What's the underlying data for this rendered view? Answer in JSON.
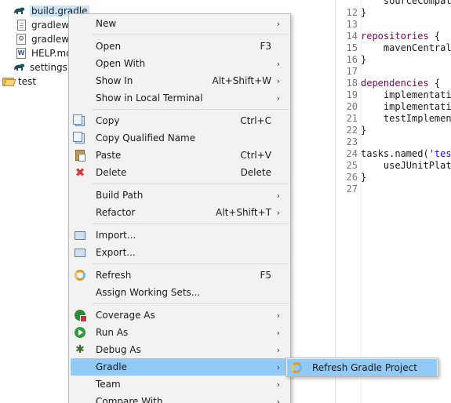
{
  "explorer": {
    "items": [
      {
        "label": "build.gradle",
        "icon": "gradle-file-icon",
        "selected": true
      },
      {
        "label": "gradlew",
        "icon": "text-file-icon"
      },
      {
        "label": "gradlew.b",
        "icon": "batch-file-icon"
      },
      {
        "label": "HELP.md",
        "icon": "markdown-file-icon"
      },
      {
        "label": "settings.g",
        "icon": "gradle-file-icon"
      },
      {
        "label": "test",
        "icon": "folder-open-icon"
      }
    ]
  },
  "editor": {
    "lines": [
      {
        "num": "",
        "text": "    sourceCompati"
      },
      {
        "num": "12",
        "text": "}"
      },
      {
        "num": "13",
        "text": ""
      },
      {
        "num": "14",
        "text": "repositories {",
        "kw": "repositories"
      },
      {
        "num": "15",
        "text": "    mavenCentral("
      },
      {
        "num": "16",
        "text": "}"
      },
      {
        "num": "17",
        "text": ""
      },
      {
        "num": "18",
        "text": "dependencies {",
        "kw": "dependencies"
      },
      {
        "num": "19",
        "text": "    implementatio"
      },
      {
        "num": "20",
        "text": "    implementatio"
      },
      {
        "num": "21",
        "text": "    testImplement"
      },
      {
        "num": "22",
        "text": "}"
      },
      {
        "num": "23",
        "text": ""
      },
      {
        "num": "24",
        "text": "tasks.named('test",
        "str": "'test"
      },
      {
        "num": "25",
        "text": "    useJUnitPlatf"
      },
      {
        "num": "26",
        "text": "}"
      },
      {
        "num": "27",
        "text": ""
      }
    ]
  },
  "context_menu": {
    "items": [
      {
        "label": "New",
        "submenu": true
      },
      {
        "sep": true
      },
      {
        "label": "Open",
        "accel": "F3"
      },
      {
        "label": "Open With",
        "submenu": true
      },
      {
        "label": "Show In",
        "accel": "Alt+Shift+W",
        "submenu": true
      },
      {
        "label": "Show in Local Terminal",
        "submenu": true
      },
      {
        "sep": true
      },
      {
        "label": "Copy",
        "accel": "Ctrl+C",
        "icon": "copy-icon"
      },
      {
        "label": "Copy Qualified Name",
        "icon": "copy-qualified-name-icon"
      },
      {
        "label": "Paste",
        "accel": "Ctrl+V",
        "icon": "paste-icon"
      },
      {
        "label": "Delete",
        "accel": "Delete",
        "icon": "delete-icon"
      },
      {
        "sep": true
      },
      {
        "label": "Build Path",
        "submenu": true
      },
      {
        "label": "Refactor",
        "accel": "Alt+Shift+T",
        "submenu": true
      },
      {
        "sep": true
      },
      {
        "label": "Import...",
        "icon": "import-icon"
      },
      {
        "label": "Export...",
        "icon": "export-icon"
      },
      {
        "sep": true
      },
      {
        "label": "Refresh",
        "accel": "F5",
        "icon": "refresh-icon"
      },
      {
        "label": "Assign Working Sets..."
      },
      {
        "sep": true
      },
      {
        "label": "Coverage As",
        "submenu": true,
        "icon": "coverage-icon"
      },
      {
        "label": "Run As",
        "submenu": true,
        "icon": "run-icon"
      },
      {
        "label": "Debug As",
        "submenu": true,
        "icon": "debug-icon"
      },
      {
        "label": "Gradle",
        "submenu": true,
        "highlighted": true
      },
      {
        "label": "Team",
        "submenu": true
      },
      {
        "label": "Compare With",
        "submenu": true
      }
    ]
  },
  "gradle_submenu": {
    "items": [
      {
        "label": "Refresh Gradle Project",
        "icon": "refresh-gradle-icon"
      }
    ]
  },
  "colors": {
    "menu_bg": "#f2f2f2",
    "highlight": "#91c9f7",
    "selection": "#cce4f7",
    "keyword": "#7f0055",
    "string": "#2a00ff"
  }
}
